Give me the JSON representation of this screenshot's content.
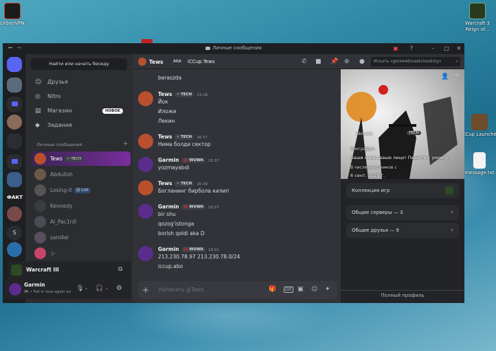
{
  "desktop": {
    "icons": [
      {
        "label": "UrbanVPN"
      },
      {
        "label": "Warcraft 3 Reign of..."
      },
      {
        "label": "ICCup Launcher"
      },
      {
        "label": "message.txt"
      }
    ]
  },
  "window": {
    "title": "Личные сообщения",
    "back": "←",
    "forward": "→"
  },
  "sidebar": {
    "search_button": "Найти или начать беседу",
    "nav": [
      {
        "label": "Друзья",
        "icon": "friends-icon"
      },
      {
        "label": "Nitro",
        "icon": "nitro-icon"
      },
      {
        "label": "Магазин",
        "icon": "shop-icon",
        "badge": "НОВОЕ"
      },
      {
        "label": "Задания",
        "icon": "quests-icon"
      }
    ],
    "dm_header": "Личные сообщения",
    "dm_add": "+",
    "dms": [
      {
        "name": "Tews",
        "tag": "✧ TECH"
      },
      {
        "name": "Abdulloh",
        "tag": ""
      },
      {
        "name": "Losing-it",
        "tag": "🐱 CAT"
      },
      {
        "name": "Kennedy",
        "tag": ""
      },
      {
        "name": "Al_Pac1n0",
        "tag": ""
      },
      {
        "name": "sani4el",
        "tag": ""
      },
      {
        "name": "シ",
        "tag": ""
      }
    ],
    "server_label": "ФАКТ",
    "server_s": "S",
    "voice": {
      "title": "Warcraft III"
    },
    "user": {
      "name": "Garmin",
      "status": "Fall in love again an"
    }
  },
  "chat_header": {
    "user": "Tews",
    "aka_label": "AKA",
    "aka_value": "iCCup.Tews",
    "search_placeholder": "Искать «geniewbivaetvixodnoy»"
  },
  "messages": [
    {
      "lines": [
        "beraszda"
      ]
    },
    {
      "author": "Tews",
      "tag": "✧ TECH",
      "time": "13:18",
      "lines": [
        "Йок",
        "Иложи",
        "Лекин"
      ]
    },
    {
      "author": "Tews",
      "tag": "✧ TECH",
      "time": "16:37",
      "lines": [
        "Нима болди сектор"
      ]
    },
    {
      "author": "Garmin",
      "tag": "🐞 WUWA",
      "time": "16:37",
      "lines": [
        "yozmayabdi"
      ]
    },
    {
      "author": "Tews",
      "tag": "✧ TECH",
      "time": "16:39",
      "lines": [
        "Богланинг бирбола килип"
      ]
    },
    {
      "author": "Garmin",
      "tag": "🐞 WUWA",
      "time": "16:57",
      "lines": [
        "bir shu",
        "qozog'istonga",
        "borish qoldi aka D"
      ]
    },
    {
      "author": "Garmin",
      "tag": "🐞 WUWA",
      "time": "18:01",
      "lines": [
        "213.230.78.97 213.230.78.0/24",
        "iccup.abo"
      ]
    }
  ],
  "composer": {
    "placeholder": "Написать @Tews",
    "plus": "+"
  },
  "profile": {
    "bio_label": "Биография",
    "bio_text": "Ваши слова ваше лицо! Пишите с умом😁",
    "member_since_label": "В числе участников с",
    "member_since": "6 сент. 2025 г.",
    "name_fragment": "ebivaet",
    "tag": "TECH",
    "games_label": "Коллекция игр",
    "mutual_servers": "Общие серверы — 3",
    "mutual_friends": "Общие друзья — 9",
    "full_profile": "Полный профиль"
  }
}
